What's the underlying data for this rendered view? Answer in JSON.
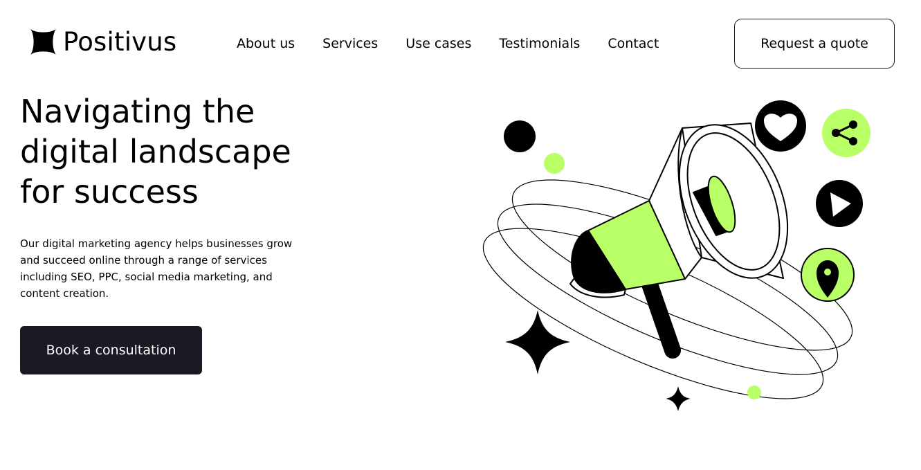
{
  "brand": {
    "name": "Positivus",
    "icon": "four-point-star-icon"
  },
  "nav": {
    "items": [
      {
        "label": "About us"
      },
      {
        "label": "Services"
      },
      {
        "label": "Use cases"
      },
      {
        "label": "Testimonials"
      },
      {
        "label": "Contact"
      }
    ],
    "quote_label": "Request a quote"
  },
  "hero": {
    "title_lines": [
      "Navigating the",
      "digital landscape",
      "for success"
    ],
    "description": "Our digital marketing agency helps businesses grow and succeed online through a range of services including SEO, PPC, social media marketing, and content creation.",
    "cta_label": "Book a consultation"
  },
  "colors": {
    "accent": "#B9FF66",
    "dark": "#191A23",
    "background": "#FFFFFF"
  },
  "illustration": {
    "icons": [
      "megaphone-icon",
      "heart-icon",
      "share-icon",
      "play-icon",
      "location-pin-icon",
      "sparkle-icon"
    ]
  }
}
